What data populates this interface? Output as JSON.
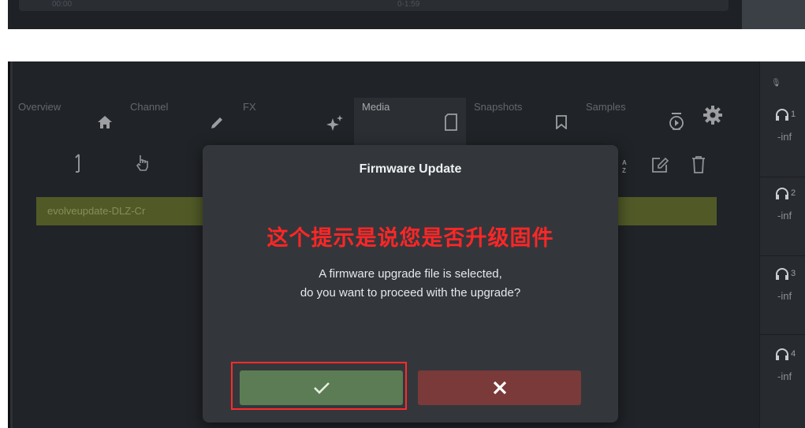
{
  "top_strip": {
    "time_start": "00:00",
    "time_end": "0-1:59"
  },
  "tabs": [
    {
      "label": "Overview",
      "icon": "home-icon"
    },
    {
      "label": "Channel",
      "icon": "pencil-icon"
    },
    {
      "label": "FX",
      "icon": "sparkle-icon"
    },
    {
      "label": "Media",
      "icon": "sd-card-icon",
      "active": true
    },
    {
      "label": "Snapshots",
      "icon": "bookmark-icon"
    },
    {
      "label": "Samples",
      "icon": "sample-icon"
    }
  ],
  "file_row": {
    "name": "evolveupdate-DLZ-Cr"
  },
  "channels": [
    {
      "number": "1",
      "level": "-inf"
    },
    {
      "number": "2",
      "level": "-inf"
    },
    {
      "number": "3",
      "level": "-inf"
    },
    {
      "number": "4",
      "level": "-inf"
    }
  ],
  "modal": {
    "title": "Firmware Update",
    "annotation": "这个提示是说您是否升级固件",
    "message_line1": "A firmware upgrade file is selected,",
    "message_line2": "do you want to proceed with the upgrade?",
    "confirm_icon": "checkmark-icon",
    "cancel_icon": "close-icon"
  },
  "colors": {
    "confirm": "#5b7c54",
    "cancel": "#7a3a39",
    "annotation": "#ff2626",
    "file_row": "#717d36"
  }
}
